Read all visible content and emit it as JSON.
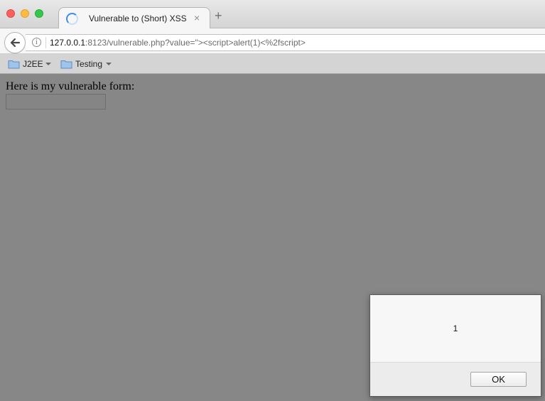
{
  "browser": {
    "tab": {
      "title": "Vulnerable to (Short) XSS",
      "close_glyph": "×"
    },
    "new_tab_glyph": "+",
    "address": {
      "host": "127.0.0.1",
      "rest": ":8123/vulnerable.php?value=\"><script>alert(1)<%2fscript>"
    },
    "bookmarks": [
      {
        "label": "J2EE",
        "icon": "folder-icon"
      },
      {
        "label": "Testing",
        "icon": "folder-icon"
      }
    ],
    "icons": {
      "back": "back-arrow-icon",
      "info": "info-icon",
      "loading": "loading-spinner-icon"
    }
  },
  "page": {
    "heading": "Here is my vulnerable form:",
    "input_value": ""
  },
  "alert": {
    "message": "1",
    "ok_label": "OK"
  },
  "colors": {
    "page_background": "#878787",
    "traffic_red": "#fc605c",
    "traffic_yellow": "#fdbc40",
    "traffic_green": "#34c84a",
    "spinner_accent": "#3d8ee8"
  }
}
